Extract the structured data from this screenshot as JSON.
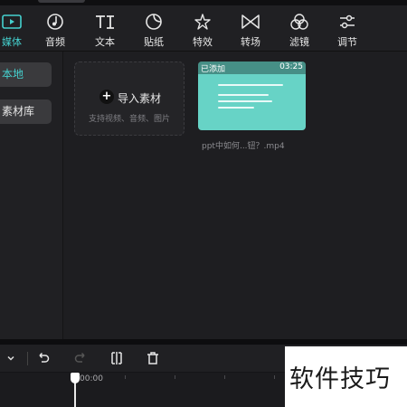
{
  "toolbar": {
    "items": [
      {
        "label": "媒体",
        "icon": "media-icon",
        "active": true
      },
      {
        "label": "音频",
        "icon": "music-icon"
      },
      {
        "label": "文本",
        "icon": "text-icon"
      },
      {
        "label": "贴纸",
        "icon": "sticker-icon"
      },
      {
        "label": "特效",
        "icon": "effects-icon"
      },
      {
        "label": "转场",
        "icon": "transition-icon"
      },
      {
        "label": "滤镜",
        "icon": "filter-icon"
      },
      {
        "label": "调节",
        "icon": "adjust-icon"
      }
    ],
    "accent_color": "#45d1cf"
  },
  "sidebar": {
    "items": [
      {
        "label": "本地",
        "active": true
      },
      {
        "label": "素材库"
      }
    ]
  },
  "media": {
    "import": {
      "title": "导入素材",
      "subtitle": "支持视频、音频、图片"
    },
    "clip": {
      "badge": "已添加",
      "duration": "03:25",
      "name": "ppt中如何...钮？.mp4",
      "thumb_color": "#67d3c6"
    }
  },
  "timeline": {
    "timecode": "00:00",
    "icons": [
      "chevron-down-icon",
      "undo-icon",
      "redo-icon",
      "split-icon",
      "delete-icon"
    ]
  },
  "watermark": {
    "text": "软件技巧"
  }
}
